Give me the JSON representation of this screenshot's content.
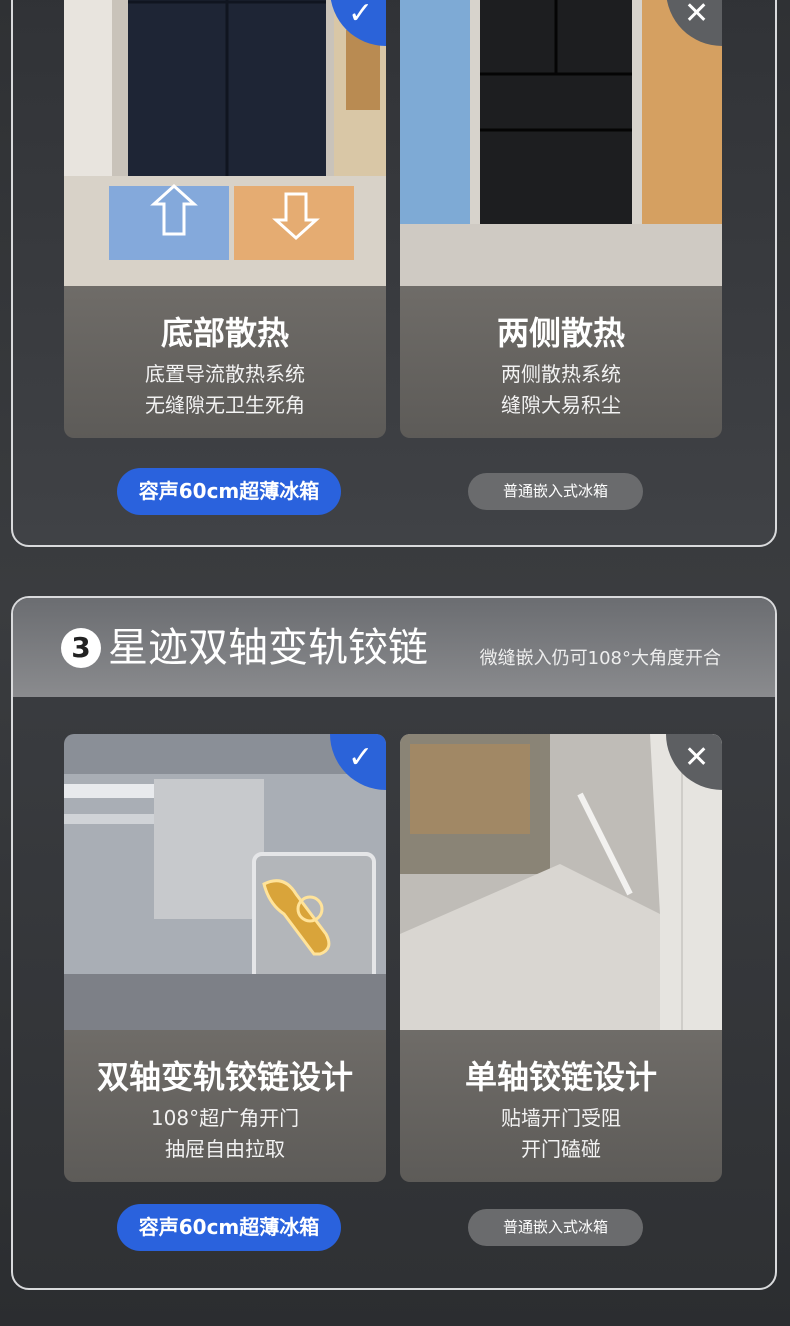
{
  "section2": {
    "cards": [
      {
        "title": "底部散热",
        "line1": "底置导流散热系统",
        "line2": "无缝隙无卫生死角",
        "badge": "✓"
      },
      {
        "title": "两侧散热",
        "line1": "两侧散热系统",
        "line2": "缝隙大易积尘",
        "badge": "✕"
      }
    ],
    "pill_ours": "容声60cm超薄冰箱",
    "pill_other": "普通嵌入式冰箱"
  },
  "section3": {
    "number": "3",
    "title": "星迹双轴变轨铰链",
    "subtitle": "微缝嵌入仍可108°大角度开合",
    "cards": [
      {
        "title": "双轴变轨铰链设计",
        "line1": "108°超广角开门",
        "line2": "抽屉自由拉取",
        "badge": "✓"
      },
      {
        "title": "单轴铰链设计",
        "line1": "贴墙开门受阻",
        "line2": "开门磕碰",
        "badge": "✕"
      }
    ],
    "pill_ours": "容声60cm超薄冰箱",
    "pill_other": "普通嵌入式冰箱"
  },
  "colors": {
    "accent_blue": "#2a62dd",
    "pill_grey": "#6a6b6d"
  }
}
